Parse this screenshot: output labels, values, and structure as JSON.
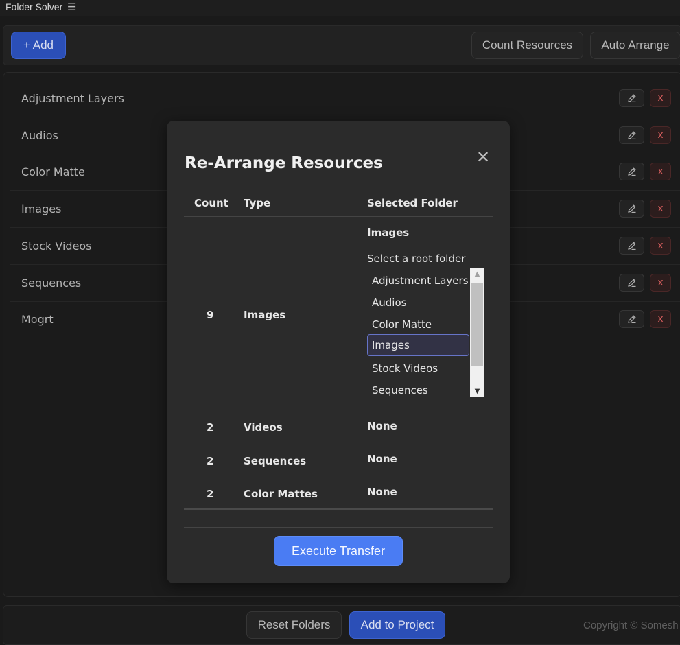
{
  "app": {
    "title": "Folder Solver",
    "menu_icon": "hamburger-menu-icon"
  },
  "toolbar": {
    "add_label": "+ Add",
    "count_label": "Count Resources",
    "auto_label": "Auto Arrange"
  },
  "folders": [
    {
      "label": "Adjustment Layers"
    },
    {
      "label": "Audios"
    },
    {
      "label": "Color Matte"
    },
    {
      "label": "Images"
    },
    {
      "label": "Stock Videos"
    },
    {
      "label": "Sequences"
    },
    {
      "label": "Mogrt"
    }
  ],
  "row_actions": {
    "edit_icon": "pencil-icon",
    "delete_label": "x"
  },
  "footer": {
    "reset_label": "Reset Folders",
    "add_project_label": "Add to Project",
    "copyright": "Copyright © Somesh"
  },
  "modal": {
    "title": "Re-Arrange Resources",
    "close_glyph": "✕",
    "headers": {
      "count": "Count",
      "type": "Type",
      "folder": "Selected Folder"
    },
    "rows": [
      {
        "count": "9",
        "type": "Images",
        "folder": "Images",
        "select_prompt": "Select a root folder",
        "options": [
          "Adjustment Layers",
          "Audios",
          "Color Matte",
          "Images",
          "Stock Videos",
          "Sequences"
        ],
        "selected_option": "Images"
      },
      {
        "count": "2",
        "type": "Videos",
        "folder": "None"
      },
      {
        "count": "2",
        "type": "Sequences",
        "folder": "None"
      },
      {
        "count": "2",
        "type": "Color Mattes",
        "folder": "None"
      }
    ],
    "execute_label": "Execute Transfer"
  },
  "colors": {
    "accent": "#4a7cf3",
    "primary_button": "#2b4fb7",
    "danger": "#d05b5b",
    "background": "#1a1a1a",
    "modal_bg": "#2b2b2b"
  }
}
